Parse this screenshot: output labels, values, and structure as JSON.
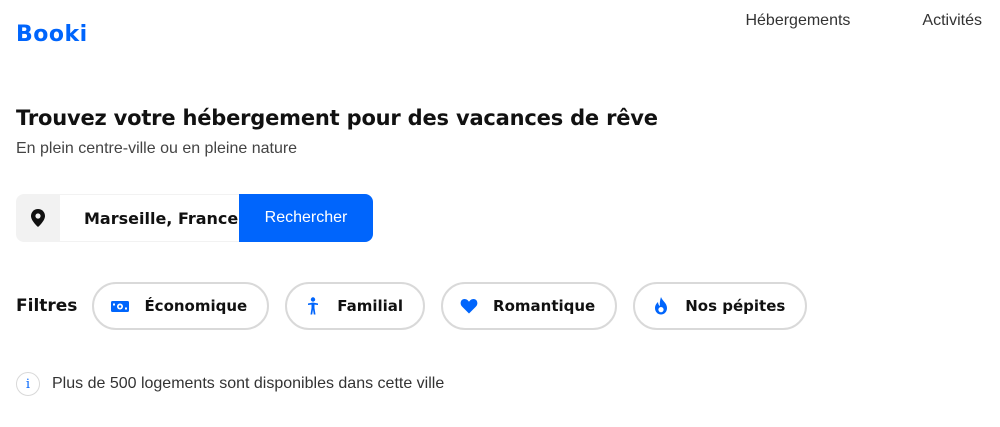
{
  "brand": {
    "logo_text": "Booki",
    "accent": "#0065fc"
  },
  "nav": {
    "items": [
      {
        "label": "Hébergements"
      },
      {
        "label": "Activités"
      }
    ]
  },
  "hero": {
    "title": "Trouvez votre hébergement pour des vacances de rêve",
    "subtitle": "En plein centre-ville ou en pleine nature"
  },
  "search": {
    "icon": "map-pin-icon",
    "value": "Marseille, France",
    "button_label": "Rechercher"
  },
  "filters": {
    "title": "Filtres",
    "items": [
      {
        "label": "Économique",
        "icon": "money-icon"
      },
      {
        "label": "Familial",
        "icon": "child-icon"
      },
      {
        "label": "Romantique",
        "icon": "heart-icon"
      },
      {
        "label": "Nos pépites",
        "icon": "fire-icon"
      }
    ]
  },
  "info": {
    "icon": "info-icon",
    "glyph": "i",
    "text": "Plus de 500 logements sont disponibles dans cette ville"
  }
}
